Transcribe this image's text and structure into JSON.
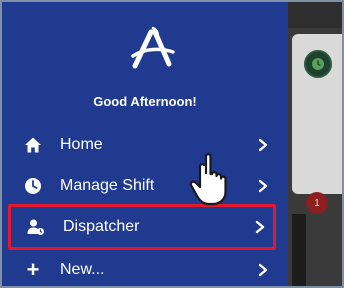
{
  "drawer": {
    "greeting": "Good Afternoon!",
    "logo_icon": "brand-a-logo-icon",
    "background_color": "#203a8f",
    "highlight_color": "#e3182d",
    "items": [
      {
        "label": "Home",
        "icon": "home-icon",
        "chevron": "chevron-right-icon"
      },
      {
        "label": "Manage Shift",
        "icon": "clock-icon",
        "chevron": "chevron-right-icon"
      },
      {
        "label": "Dispatcher",
        "icon": "dispatcher-user-icon",
        "chevron": "chevron-right-icon",
        "highlighted": true
      },
      {
        "label": "New...",
        "icon": "plus-icon",
        "chevron": "chevron-right-icon"
      }
    ]
  },
  "backdrop": {
    "badge_count": "1"
  },
  "overlay": {
    "cursor_icon": "pointing-hand-cursor-icon"
  }
}
